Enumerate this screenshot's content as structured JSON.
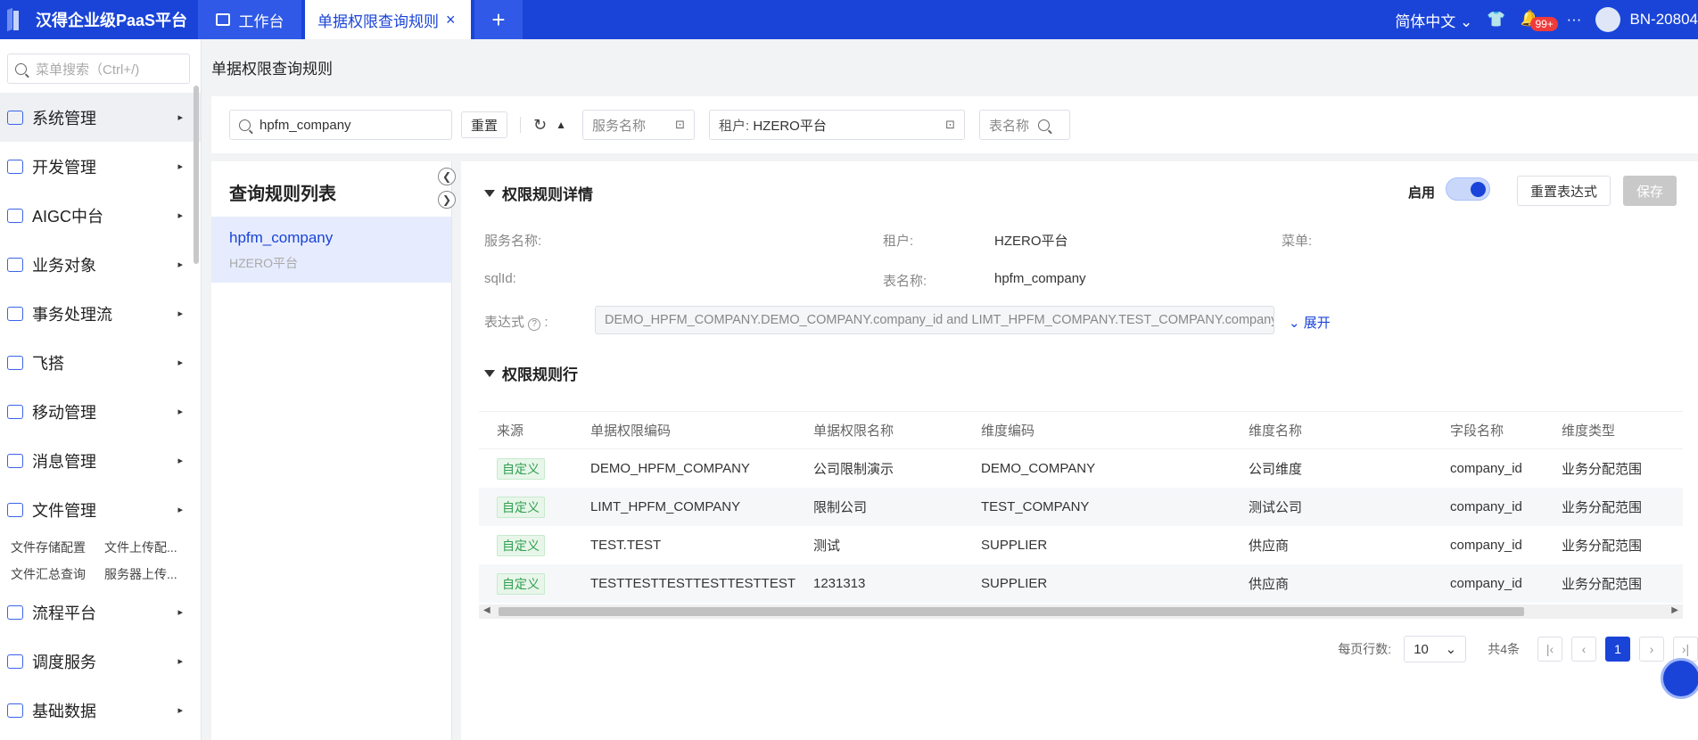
{
  "topbar": {
    "app_title": "汉得企业级PaaS平台",
    "tabs": [
      {
        "label": "工作台"
      },
      {
        "label": "单据权限查询规则"
      }
    ],
    "plus": "+",
    "close": "×",
    "language": "简体中文",
    "notification_count": "99+",
    "user": "BN-20804",
    "more": "···"
  },
  "sidebar": {
    "search_placeholder": "菜单搜索（Ctrl+/)",
    "items": [
      {
        "label": "系统管理"
      },
      {
        "label": "开发管理"
      },
      {
        "label": "AIGC中台"
      },
      {
        "label": "业务对象"
      },
      {
        "label": "事务处理流"
      },
      {
        "label": "飞搭"
      },
      {
        "label": "移动管理"
      },
      {
        "label": "消息管理"
      },
      {
        "label": "文件管理"
      },
      {
        "label": "流程平台"
      },
      {
        "label": "调度服务"
      },
      {
        "label": "基础数据"
      }
    ],
    "file_sub": [
      "文件存储配置",
      "文件上传配...",
      "文件汇总查询",
      "服务器上传..."
    ]
  },
  "page_title": "单据权限查询规则",
  "toolbar": {
    "search_value": "hpfm_company",
    "reset_label": "重置",
    "service_placeholder": "服务名称",
    "tenant_label": "租户:",
    "tenant_value": "HZERO平台",
    "table_placeholder": "表名称"
  },
  "list": {
    "title": "查询规则列表",
    "item_name": "hpfm_company",
    "item_sub": "HZERO平台"
  },
  "detail": {
    "section1": "权限规则详情",
    "enable_label": "启用",
    "reset_expr_label": "重置表达式",
    "save_label": "保存",
    "service_label": "服务名称:",
    "tenant_label": "租户:",
    "tenant_value": "HZERO平台",
    "menu_label": "菜单:",
    "sqlid_label": "sqlId:",
    "table_label": "表名称:",
    "table_value": "hpfm_company",
    "expr_label": "表达式",
    "expr_value": "DEMO_HPFM_COMPANY.DEMO_COMPANY.company_id and LIMT_HPFM_COMPANY.TEST_COMPANY.company_",
    "expand_label": "展开",
    "section2": "权限规则行"
  },
  "table": {
    "headers": [
      "来源",
      "单据权限编码",
      "单据权限名称",
      "维度编码",
      "维度名称",
      "字段名称",
      "维度类型"
    ],
    "rows": [
      [
        "自定义",
        "DEMO_HPFM_COMPANY",
        "公司限制演示",
        "DEMO_COMPANY",
        "公司维度",
        "company_id",
        "业务分配范围"
      ],
      [
        "自定义",
        "LIMT_HPFM_COMPANY",
        "限制公司",
        "TEST_COMPANY",
        "测试公司",
        "company_id",
        "业务分配范围"
      ],
      [
        "自定义",
        "TEST.TEST",
        "测试",
        "SUPPLIER",
        "供应商",
        "company_id",
        "业务分配范围"
      ],
      [
        "自定义",
        "TESTTESTTESTTESTTESTTEST",
        "1231313",
        "SUPPLIER",
        "供应商",
        "company_id",
        "业务分配范围"
      ]
    ]
  },
  "pager": {
    "rows_label": "每页行数:",
    "page_size": "10",
    "total": "共4条",
    "current_page": "1"
  }
}
